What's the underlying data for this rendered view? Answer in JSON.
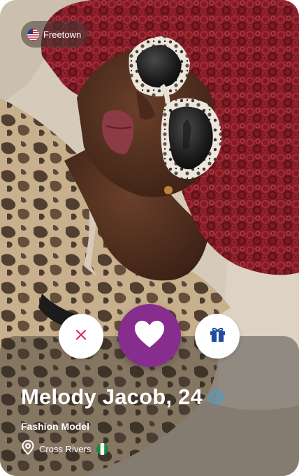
{
  "location_chip": {
    "label": "Freetown",
    "flag_icon": "us-flag-icon"
  },
  "profile": {
    "name_age": "Melody Jacob, 24",
    "verified_icon": "verified-badge-icon",
    "occupation": "Fashion Model",
    "location": "Cross Rivers",
    "location_flag_icon": "nigeria-flag-icon"
  },
  "actions": {
    "dislike_icon": "close-icon",
    "like_icon": "heart-icon",
    "gift_icon": "gift-icon"
  },
  "colors": {
    "like_button": "#862d8e",
    "dislike_icon": "#d8264a",
    "gift_icon": "#1f4e9b",
    "verified_badge": "#2aa8e8",
    "hair": "#8e1f2a"
  }
}
